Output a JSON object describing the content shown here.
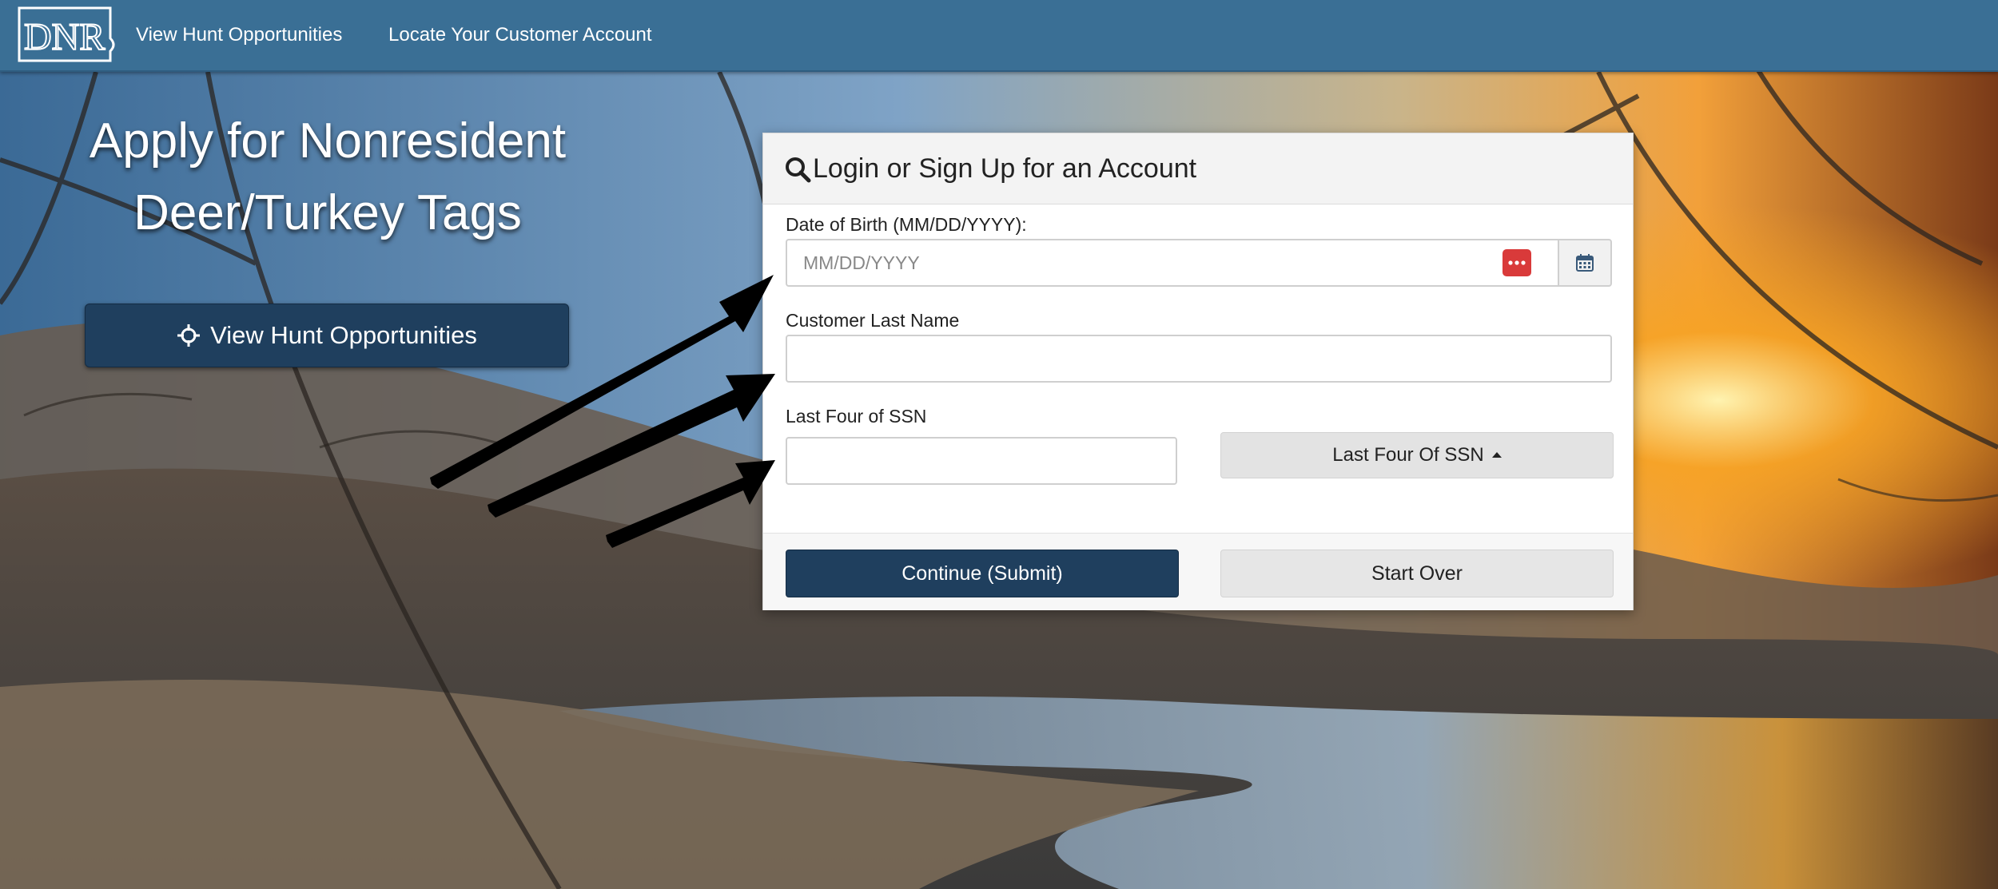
{
  "navbar": {
    "logo_text": "DNR",
    "links": [
      "View Hunt Opportunities",
      "Locate Your Customer Account"
    ]
  },
  "hero": {
    "title": "Apply for Nonresident Deer/Turkey Tags",
    "button_label": "View Hunt Opportunities"
  },
  "panel": {
    "title": "Login or Sign Up for an Account",
    "dob_label": "Date of Birth (MM/DD/YYYY):",
    "dob_placeholder": "MM/DD/YYYY",
    "last_name_label": "Customer Last Name",
    "last_name_value": "",
    "ssn_label": "Last Four of SSN",
    "ssn_value": "",
    "ssn_toggle_label": "Last Four Of SSN",
    "submit_label": "Continue (Submit)",
    "start_over_label": "Start Over"
  },
  "colors": {
    "navbar": "#3a6f95",
    "primary_button": "#1f3f5e",
    "password_badge": "#d93a3a"
  },
  "icons": [
    "dnr-logo-icon",
    "crosshair-icon",
    "search-icon",
    "password-manager-icon",
    "calendar-icon",
    "caret-up-icon"
  ]
}
